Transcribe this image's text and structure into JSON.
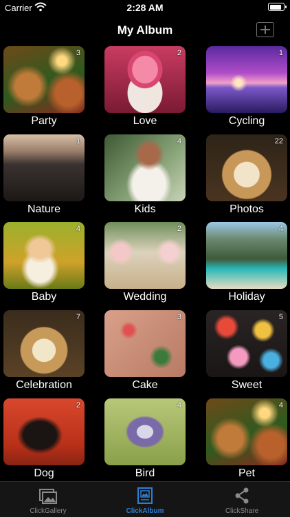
{
  "status": {
    "carrier": "Carrier",
    "time": "2:28 AM",
    "battery_level": 0.9
  },
  "nav": {
    "title": "My Album"
  },
  "albums": [
    {
      "name": "Party",
      "count": "3"
    },
    {
      "name": "Love",
      "count": "2"
    },
    {
      "name": "Cycling",
      "count": "1"
    },
    {
      "name": "Nature",
      "count": "1"
    },
    {
      "name": "Kids",
      "count": "4"
    },
    {
      "name": "Photos",
      "count": "22"
    },
    {
      "name": "Baby",
      "count": "4"
    },
    {
      "name": "Wedding",
      "count": "2"
    },
    {
      "name": "Holiday",
      "count": "4"
    },
    {
      "name": "Celebration",
      "count": "7"
    },
    {
      "name": "Cake",
      "count": "3"
    },
    {
      "name": "Sweet",
      "count": "5"
    },
    {
      "name": "Dog",
      "count": "2"
    },
    {
      "name": "Bird",
      "count": "4"
    },
    {
      "name": "Pet",
      "count": "4"
    }
  ],
  "tabs": [
    {
      "label": "ClickGallery",
      "icon": "gallery-icon"
    },
    {
      "label": "ClickAlbum",
      "icon": "album-icon"
    },
    {
      "label": "ClickShare",
      "icon": "share-icon"
    }
  ],
  "colors": {
    "active_tab": "#2d7fd6",
    "inactive_tab": "#8a8a8a",
    "background": "#000000"
  }
}
